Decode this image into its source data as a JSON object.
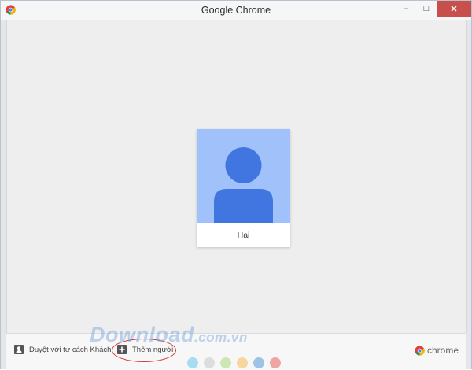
{
  "window": {
    "title": "Google Chrome",
    "controls": {
      "minimize": "–",
      "maximize": "□",
      "close": "✕"
    }
  },
  "profiles": [
    {
      "name": "Hai",
      "avatar_color": "#a1c1fa",
      "avatar_figure_color": "#4176e0"
    }
  ],
  "bottom_bar": {
    "guest_label": "Duyệt với tư cách Khách",
    "add_person_label": "Thêm người",
    "color_dots": [
      "#a8dcf3",
      "#dddddd",
      "#cde7b4",
      "#f8d79d",
      "#9ec3e4",
      "#f0a4a4"
    ],
    "brand": "chrome"
  },
  "watermark": {
    "main": "Download",
    "suffix": ".com.vn"
  },
  "annotation_color": "#d23a3a"
}
